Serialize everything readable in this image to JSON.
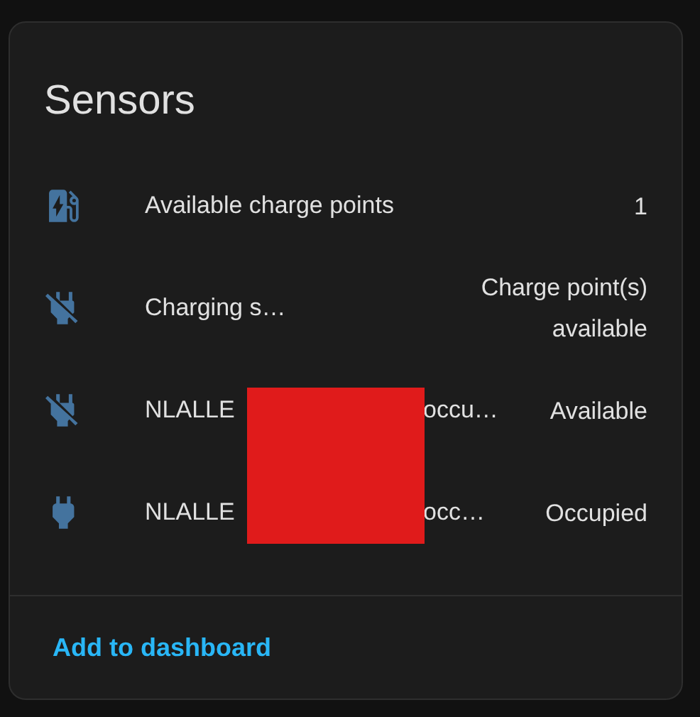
{
  "card": {
    "title": "Sensors",
    "rows": [
      {
        "kind": "station",
        "name": "Available charge points",
        "value": "1"
      },
      {
        "kind": "unplugged",
        "name": "Charging s…",
        "value": "Charge point(s) available"
      },
      {
        "kind": "unplugged",
        "name": "NLALLE",
        "name_end": "occu…",
        "value": "Available"
      },
      {
        "kind": "plugged",
        "name": "NLALLE",
        "name_end": "occ…",
        "value": "Occupied"
      }
    ],
    "redaction_box": true,
    "action": "Add to dashboard"
  }
}
